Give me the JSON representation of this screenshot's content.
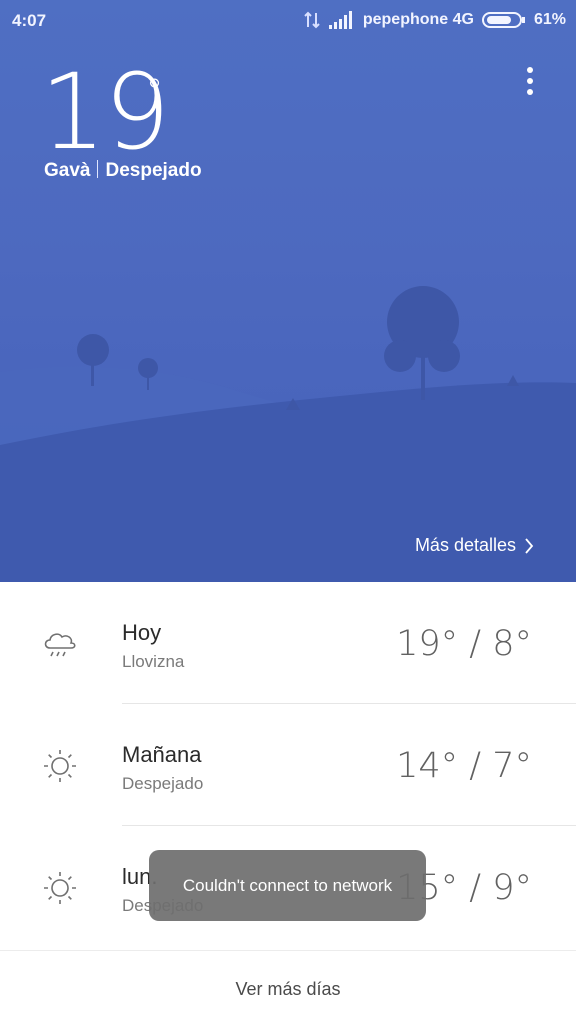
{
  "status_bar": {
    "time": "4:07",
    "carrier": "pepephone 4G",
    "battery_percent": "61%",
    "icons": [
      "data-transfer-icon",
      "signal-icon",
      "battery-icon"
    ]
  },
  "current": {
    "temperature": "19",
    "degree_symbol": "°",
    "city": "Gavà",
    "condition": "Despejado",
    "more_details_label": "Más detalles"
  },
  "forecast": [
    {
      "day": "Hoy",
      "condition": "Llovizna",
      "range": "19° / 8°",
      "icon": "drizzle-cloud-icon"
    },
    {
      "day": "Mañana",
      "condition": "Despejado",
      "range": "14° / 7°",
      "icon": "sun-icon"
    },
    {
      "day": "lun.",
      "condition": "Despejado",
      "range": "15° / 9°",
      "icon": "sun-icon"
    }
  ],
  "more_days_label": "Ver más días",
  "toast": {
    "message": "Couldn't connect to network"
  },
  "colors": {
    "hero_top": "#4f6fc3",
    "hero_bottom": "#4460b9",
    "hill_dark": "#3f5aae",
    "text_primary": "#2b2b2b",
    "text_secondary": "#7a7a7a"
  }
}
